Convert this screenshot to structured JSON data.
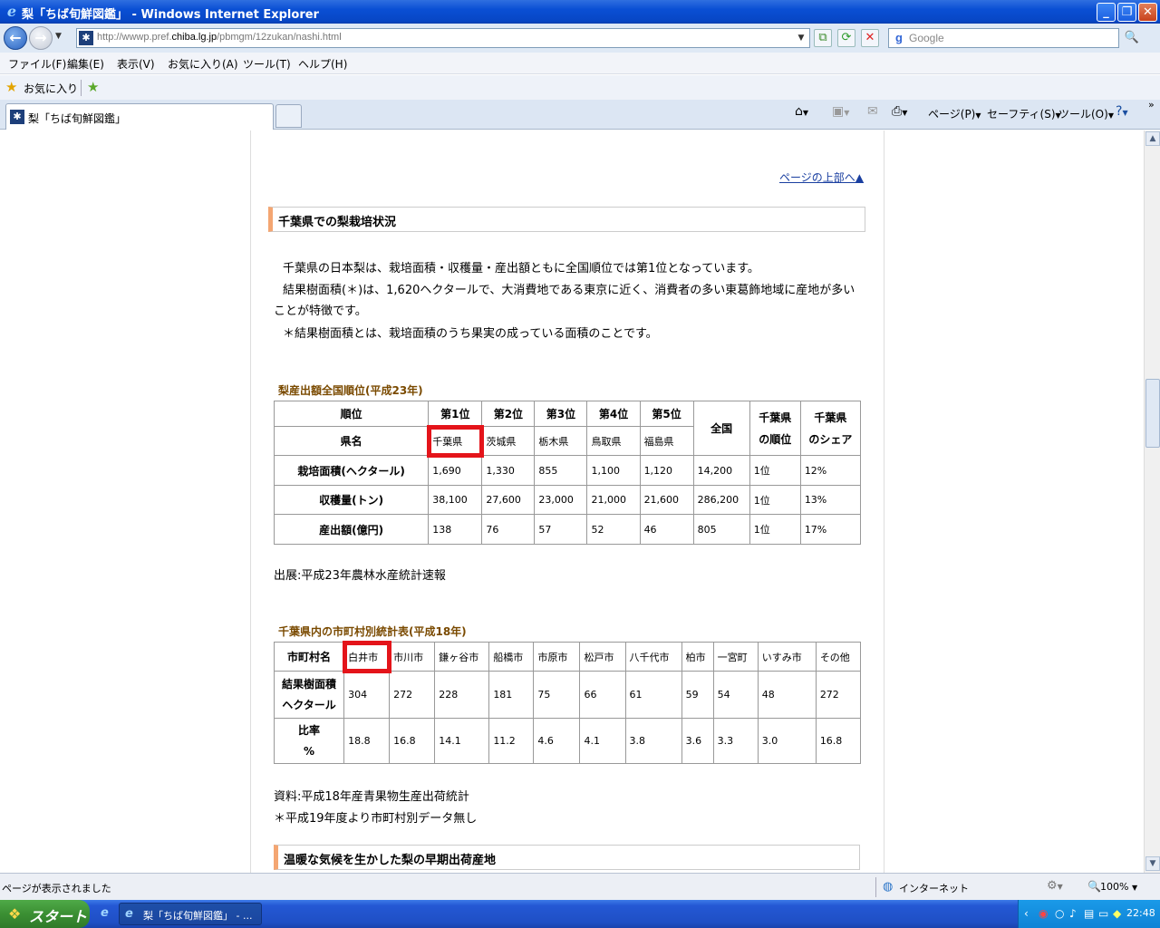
{
  "window": {
    "title": "梨「ちば旬鮮図鑑」 - Windows Internet Explorer",
    "min": "_",
    "max": "❐",
    "close": "✕"
  },
  "addressbar": {
    "url_prefix": "http://wwwp.pref.",
    "url_host": "chiba.lg.jp",
    "url_path": "/pbmgm/12zukan/nashi.html",
    "search_placeholder": "Google"
  },
  "menu": [
    "ファイル(F)",
    "編集(E)",
    "表示(V)",
    "お気に入り(A)",
    "ツール(T)",
    "ヘルプ(H)"
  ],
  "favorites": {
    "label": "お気に入り"
  },
  "tab": {
    "title": "梨「ちば旬鮮図鑑」"
  },
  "commandbar": {
    "page": "ページ(P)",
    "safety": "セーフティ(S)",
    "tools": "ツール(O)"
  },
  "content": {
    "page_top_link": "ページの上部へ▲",
    "section1_title": "千葉県での梨栽培状況",
    "para1": "千葉県の日本梨は、栽培面積・収穫量・産出額ともに全国順位では第1位となっています。",
    "para2a": "結果樹面積(＊)は、1,620ヘクタールで、大消費地である東京に近く、消費者の多い東葛飾地域に産地が多い",
    "para2b": "ことが特徴です。",
    "para3": "＊結果樹面積とは、栽培面積のうち果実の成っている面積のことです。",
    "table1_title": "梨産出額全国順位(平成23年)",
    "table1": {
      "h_rank": "順位",
      "h_pref": "県名",
      "ranks": [
        "第1位",
        "第2位",
        "第3位",
        "第4位",
        "第5位"
      ],
      "prefs": [
        "千葉県",
        "茨城県",
        "栃木県",
        "鳥取県",
        "福島県"
      ],
      "h_national": "全国",
      "h_chiba_rank_1": "千葉県",
      "h_chiba_rank_2": "の順位",
      "h_chiba_share_1": "千葉県",
      "h_chiba_share_2": "のシェア",
      "rows": [
        {
          "label": "栽培面積(ヘクタール)",
          "values": [
            "1,690",
            "1,330",
            "855",
            "1,100",
            "1,120",
            "14,200",
            "1位",
            "12%"
          ]
        },
        {
          "label": "収穫量(トン)",
          "values": [
            "38,100",
            "27,600",
            "23,000",
            "21,000",
            "21,600",
            "286,200",
            "1位",
            "13%"
          ]
        },
        {
          "label": "産出額(億円)",
          "values": [
            "138",
            "76",
            "57",
            "52",
            "46",
            "805",
            "1位",
            "17%"
          ]
        }
      ]
    },
    "source1": "出展:平成23年農林水産統計速報",
    "table2_title": "千葉県内の市町村別統計表(平成18年)",
    "table2": {
      "h_city": "市町村名",
      "cities": [
        "白井市",
        "市川市",
        "鎌ヶ谷市",
        "船橋市",
        "市原市",
        "松戸市",
        "八千代市",
        "柏市",
        "一宮町",
        "いすみ市",
        "その他"
      ],
      "row1_label_a": "結果樹面積",
      "row1_label_b": "ヘクタール",
      "area": [
        "304",
        "272",
        "228",
        "181",
        "75",
        "66",
        "61",
        "59",
        "54",
        "48",
        "272"
      ],
      "row2_label_a": "比率",
      "row2_label_b": "%",
      "ratio": [
        "18.8",
        "16.8",
        "14.1",
        "11.2",
        "4.6",
        "4.1",
        "3.8",
        "3.6",
        "3.3",
        "3.0",
        "16.8"
      ]
    },
    "source2": "資料:平成18年産青果物生産出荷統計",
    "note2": "＊平成19年度より市町村別データ無し",
    "section2_title": "温暖な気候を生かした梨の早期出荷産地"
  },
  "statusbar": {
    "text": "ページが表示されました",
    "zone": "インターネット",
    "zoom": "100%"
  },
  "taskbar": {
    "start": "スタート",
    "task": "梨「ちば旬鮮図鑑」 - ...",
    "clock": "22:48"
  },
  "colors": {
    "highlight": "#e4141a",
    "section_accent": "#f4a672",
    "link": "#1a3fa0"
  }
}
